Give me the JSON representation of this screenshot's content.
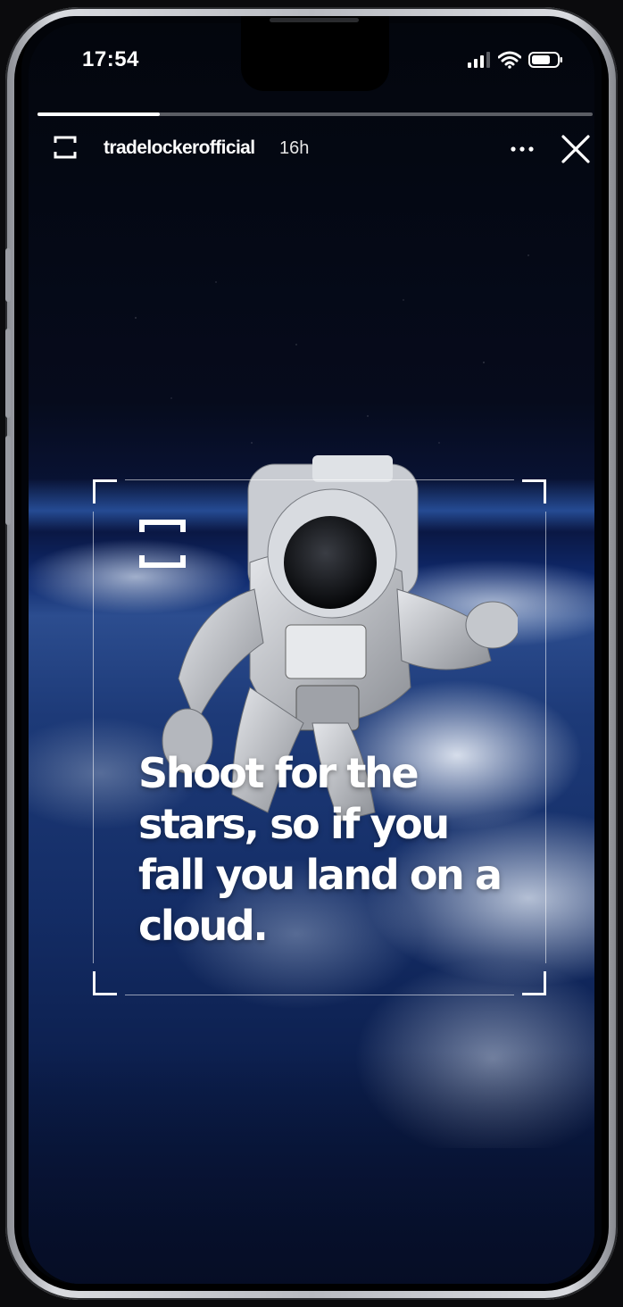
{
  "status_bar": {
    "time": "17:54",
    "icons": [
      "cellular-signal-icon",
      "wifi-icon",
      "battery-icon"
    ]
  },
  "story": {
    "progress": 0.22,
    "username": "tradelockerofficial",
    "time_ago": "16h",
    "avatar_icon": "tradelocker-logo-icon",
    "actions": [
      "more-options-icon",
      "close-icon"
    ]
  },
  "post": {
    "quote": "Shoot for the stars, so if you fall you land on a cloud.",
    "brand_icon": "tradelocker-bracket-icon"
  },
  "colors": {
    "accent": "#ffffff",
    "space_dark": "#03060d",
    "earth_blue": "#1d3a78"
  }
}
